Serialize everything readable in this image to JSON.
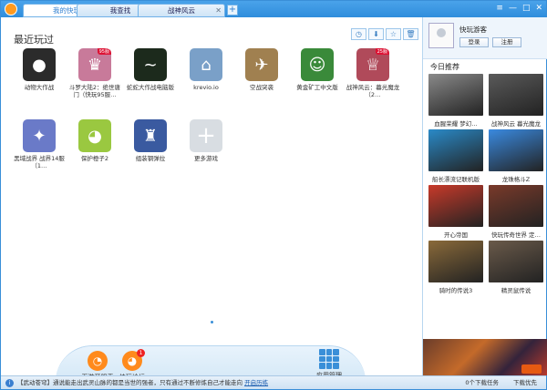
{
  "tabs": [
    {
      "label": "我的快玩",
      "active": true
    },
    {
      "label": "我查找",
      "active": false
    },
    {
      "label": "战神风云",
      "active": false
    }
  ],
  "tab_add_label": "+",
  "window_buttons": [
    "≡",
    "—",
    "□",
    "✕"
  ],
  "main": {
    "title": "最近玩过",
    "tools": [
      "◷",
      "⬇",
      "☆",
      "🗑"
    ],
    "games": [
      {
        "name": "动物大作战",
        "color": "#2b2b2b",
        "glyph": "●"
      },
      {
        "name": "斗罗大陆2：绝世唐门（快玩95服…",
        "color": "#c87a9a",
        "glyph": "♛",
        "badge": "95服"
      },
      {
        "name": "蛇蛇大作战电脑版",
        "color": "#1c2a1c",
        "glyph": "~"
      },
      {
        "name": "krevio.io",
        "color": "#7aa0c8",
        "glyph": "⌂"
      },
      {
        "name": "空战突袭",
        "color": "#a08050",
        "glyph": "✈"
      },
      {
        "name": "黄金矿工中文版",
        "color": "#3a8a3a",
        "glyph": "☺"
      },
      {
        "name": "战神风云：暮光魔龙（2…",
        "color": "#b04a5a",
        "glyph": "♕",
        "badge": "25服"
      },
      {
        "name": "黑域战界 战界14服（1…",
        "color": "#6a7ac8",
        "glyph": "✦"
      },
      {
        "name": "保护橙子2",
        "color": "#9ac840",
        "glyph": "◕"
      },
      {
        "name": "组装钢弹拉",
        "color": "#3a5aa0",
        "glyph": "♜"
      },
      {
        "name": "更多游戏",
        "color": "#d8dde2",
        "glyph": "+"
      }
    ]
  },
  "dock": {
    "items": [
      {
        "label": "页游开服表",
        "glyph": "◔"
      },
      {
        "label": "快玩论坛",
        "glyph": "◕",
        "badge": "1"
      }
    ],
    "app_manage": "应用管理"
  },
  "sidebar": {
    "username": "快玩游客",
    "login": "登录",
    "register": "注册",
    "rec_title": "今日推荐",
    "recs": [
      {
        "name": "血腥荣耀  梦幻…",
        "color": "#8a8a8a"
      },
      {
        "name": "战神风云  暮光魔龙",
        "color": "#5a5a5a"
      },
      {
        "name": "船长漂流记联机版",
        "color": "#2a8ac8"
      },
      {
        "name": "龙珠格斗Z",
        "color": "#3a8ae0"
      },
      {
        "name": "开心帝国",
        "color": "#c83a2a"
      },
      {
        "name": "快玩传奇世界  定…",
        "color": "#7a3a2a"
      },
      {
        "name": "骑时的传说3",
        "color": "#8a6a3a"
      },
      {
        "name": "精灵鼠传说",
        "color": "#6a5a4a"
      }
    ]
  },
  "status": {
    "message_prefix": "【武动苍穹】通说能走出武灵山脉的都是当世的强者，只有通过不断修炼自己才能走向",
    "link": "开启历练",
    "download": "0个下载任务",
    "optimize": "下载优先"
  }
}
